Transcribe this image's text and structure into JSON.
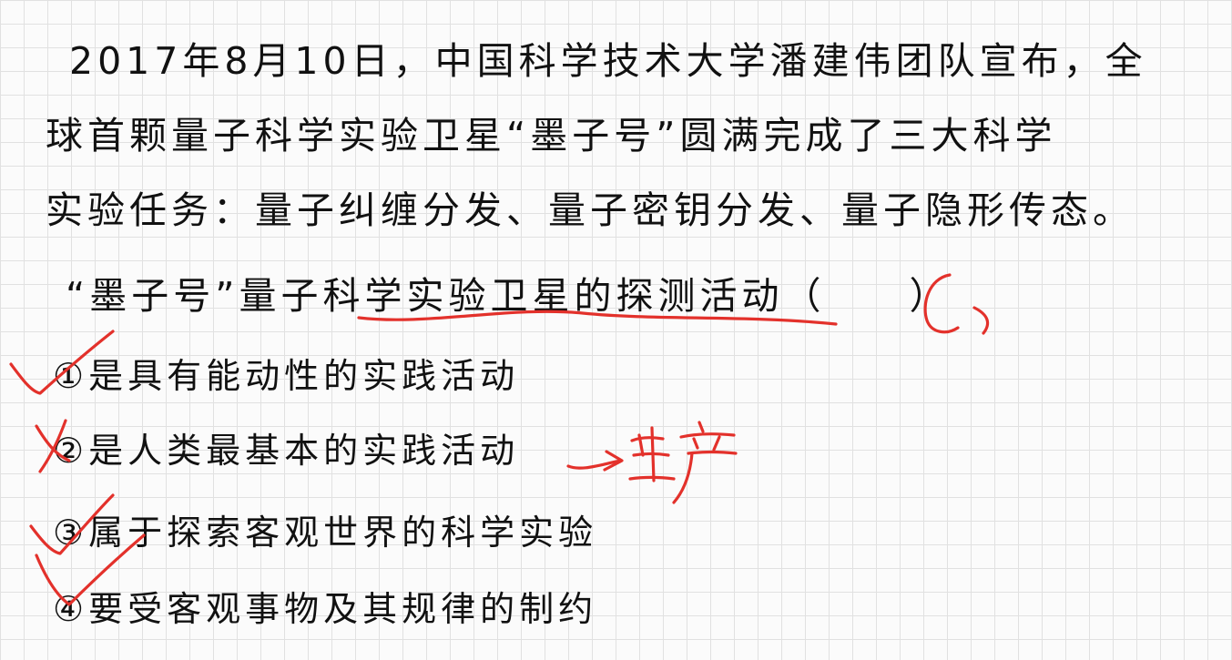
{
  "question": {
    "line1": "2017年8月10日，中国科学技术大学潘建伟团队宣布，全",
    "line2": "球首颗量子科学实验卫星“墨子号”圆满完成了三大科学",
    "line3": "实验任务：量子纠缠分发、量子密钥分发、量子隐形传态。",
    "line4": "“墨子号”量子科学实验卫星的探测活动（　　）"
  },
  "options": [
    {
      "text": "①是具有能动性的实践活动",
      "mark": "check"
    },
    {
      "text": "②是人类最基本的实践活动",
      "mark": "cross"
    },
    {
      "text": "③属于探索客观世界的科学实验",
      "mark": "check"
    },
    {
      "text": "④要受客观事物及其规律的制约",
      "mark": "check"
    }
  ],
  "annotations": {
    "answer": "C",
    "note": "生产",
    "ink_color": "#e3312b"
  }
}
